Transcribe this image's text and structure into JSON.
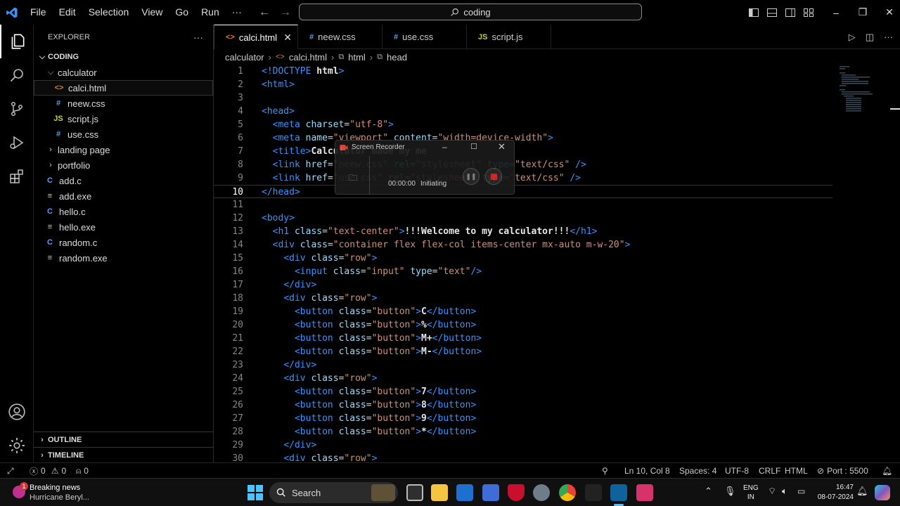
{
  "menu": [
    "File",
    "Edit",
    "Selection",
    "View",
    "Go",
    "Run",
    "···"
  ],
  "command_center": "coding",
  "sidebar": {
    "title": "EXPLORER",
    "more": "···",
    "root": "CODING",
    "tree": [
      {
        "label": "calculator",
        "type": "folder-open",
        "indent": 1
      },
      {
        "label": "calci.html",
        "type": "html",
        "indent": 2,
        "selected": true
      },
      {
        "label": "neew.css",
        "type": "css",
        "indent": 2
      },
      {
        "label": "script.js",
        "type": "js",
        "indent": 2
      },
      {
        "label": "use.css",
        "type": "css",
        "indent": 2
      },
      {
        "label": "landing page",
        "type": "folder",
        "indent": 1
      },
      {
        "label": "portfolio",
        "type": "folder",
        "indent": 1
      },
      {
        "label": "add.c",
        "type": "c",
        "indent": 1
      },
      {
        "label": "add.exe",
        "type": "exe",
        "indent": 1
      },
      {
        "label": "hello.c",
        "type": "c",
        "indent": 1
      },
      {
        "label": "hello.exe",
        "type": "exe",
        "indent": 1
      },
      {
        "label": "random.c",
        "type": "c",
        "indent": 1
      },
      {
        "label": "random.exe",
        "type": "exe",
        "indent": 1
      }
    ],
    "outline": "OUTLINE",
    "timeline": "TIMELINE"
  },
  "tabs": [
    {
      "label": "calci.html",
      "icon": "html",
      "active": true
    },
    {
      "label": "neew.css",
      "icon": "css"
    },
    {
      "label": "use.css",
      "icon": "css"
    },
    {
      "label": "script.js",
      "icon": "js"
    }
  ],
  "breadcrumb": [
    "calculator",
    "calci.html",
    "html",
    "head"
  ],
  "editor": {
    "current_line": 10,
    "lines": [
      [
        [
          "t",
          "<!DOCTYPE "
        ],
        [
          "tx",
          "html"
        ],
        [
          "t",
          ">"
        ]
      ],
      [
        [
          "t",
          "<html>"
        ]
      ],
      [],
      [
        [
          "t",
          "<head>"
        ]
      ],
      [
        [
          "n",
          "  "
        ],
        [
          "t",
          "<meta "
        ],
        [
          "at",
          "charset"
        ],
        [
          "tn",
          "="
        ],
        [
          "st",
          "\"utf-8\""
        ],
        [
          "t",
          ">"
        ]
      ],
      [
        [
          "n",
          "  "
        ],
        [
          "t",
          "<meta "
        ],
        [
          "at",
          "name"
        ],
        [
          "tn",
          "="
        ],
        [
          "st",
          "\"viewport\" "
        ],
        [
          "at",
          "content"
        ],
        [
          "tn",
          "="
        ],
        [
          "st",
          "\"width=device-width\""
        ],
        [
          "t",
          ">"
        ]
      ],
      [
        [
          "n",
          "  "
        ],
        [
          "t",
          "<title>"
        ],
        [
          "tx",
          "Calculator made my me"
        ]
      ],
      [
        [
          "n",
          "  "
        ],
        [
          "t",
          "<link "
        ],
        [
          "at",
          "href"
        ],
        [
          "tn",
          "="
        ],
        [
          "st",
          "\"neew.css\" "
        ],
        [
          "at",
          "rel"
        ],
        [
          "tn",
          "="
        ],
        [
          "st",
          "\"stylesheet\" "
        ],
        [
          "at",
          "type"
        ],
        [
          "tn",
          "="
        ],
        [
          "st",
          "\"text/css\""
        ],
        [
          "t",
          " />"
        ]
      ],
      [
        [
          "n",
          "  "
        ],
        [
          "t",
          "<link "
        ],
        [
          "at",
          "href"
        ],
        [
          "tn",
          "="
        ],
        [
          "st",
          "\"use.css\" "
        ],
        [
          "at",
          "rel"
        ],
        [
          "tn",
          "="
        ],
        [
          "st",
          "\"stylesheet\" "
        ],
        [
          "at",
          "type"
        ],
        [
          "tn",
          "="
        ],
        [
          "st",
          "\"text/css\""
        ],
        [
          "t",
          " />"
        ]
      ],
      [
        [
          "t",
          "</head>"
        ]
      ],
      [],
      [
        [
          "t",
          "<body>"
        ]
      ],
      [
        [
          "n",
          "  "
        ],
        [
          "t",
          "<h1 "
        ],
        [
          "at",
          "class"
        ],
        [
          "tn",
          "="
        ],
        [
          "st",
          "\"text-center\""
        ],
        [
          "t",
          ">"
        ],
        [
          "tx",
          "!!!Welcome to my calculator!!!"
        ],
        [
          "t",
          "</h1>"
        ]
      ],
      [
        [
          "n",
          "  "
        ],
        [
          "t",
          "<div "
        ],
        [
          "at",
          "class"
        ],
        [
          "tn",
          "="
        ],
        [
          "st",
          "\"container flex flex-col items-center mx-auto m-w-20\""
        ],
        [
          "t",
          ">"
        ]
      ],
      [
        [
          "n",
          "    "
        ],
        [
          "t",
          "<div "
        ],
        [
          "at",
          "class"
        ],
        [
          "tn",
          "="
        ],
        [
          "st",
          "\"row\""
        ],
        [
          "t",
          ">"
        ]
      ],
      [
        [
          "n",
          "      "
        ],
        [
          "t",
          "<input "
        ],
        [
          "at",
          "class"
        ],
        [
          "tn",
          "="
        ],
        [
          "st",
          "\"input\" "
        ],
        [
          "at",
          "type"
        ],
        [
          "tn",
          "="
        ],
        [
          "st",
          "\"text\""
        ],
        [
          "t",
          "/>"
        ]
      ],
      [
        [
          "n",
          "    "
        ],
        [
          "t",
          "</div>"
        ]
      ],
      [
        [
          "n",
          "    "
        ],
        [
          "t",
          "<div "
        ],
        [
          "at",
          "class"
        ],
        [
          "tn",
          "="
        ],
        [
          "st",
          "\"row\""
        ],
        [
          "t",
          ">"
        ]
      ],
      [
        [
          "n",
          "      "
        ],
        [
          "t",
          "<button "
        ],
        [
          "at",
          "class"
        ],
        [
          "tn",
          "="
        ],
        [
          "st",
          "\"button\""
        ],
        [
          "t",
          ">"
        ],
        [
          "tx",
          "C"
        ],
        [
          "t",
          "</button>"
        ]
      ],
      [
        [
          "n",
          "      "
        ],
        [
          "t",
          "<button "
        ],
        [
          "at",
          "class"
        ],
        [
          "tn",
          "="
        ],
        [
          "st",
          "\"button\""
        ],
        [
          "t",
          ">"
        ],
        [
          "tx",
          "%"
        ],
        [
          "t",
          "</button>"
        ]
      ],
      [
        [
          "n",
          "      "
        ],
        [
          "t",
          "<button "
        ],
        [
          "at",
          "class"
        ],
        [
          "tn",
          "="
        ],
        [
          "st",
          "\"button\""
        ],
        [
          "t",
          ">"
        ],
        [
          "tx",
          "M+"
        ],
        [
          "t",
          "</button>"
        ]
      ],
      [
        [
          "n",
          "      "
        ],
        [
          "t",
          "<button "
        ],
        [
          "at",
          "class"
        ],
        [
          "tn",
          "="
        ],
        [
          "st",
          "\"button\""
        ],
        [
          "t",
          ">"
        ],
        [
          "tx",
          "M-"
        ],
        [
          "t",
          "</button>"
        ]
      ],
      [
        [
          "n",
          "    "
        ],
        [
          "t",
          "</div>"
        ]
      ],
      [
        [
          "n",
          "    "
        ],
        [
          "t",
          "<div "
        ],
        [
          "at",
          "class"
        ],
        [
          "tn",
          "="
        ],
        [
          "st",
          "\"row\""
        ],
        [
          "t",
          ">"
        ]
      ],
      [
        [
          "n",
          "      "
        ],
        [
          "t",
          "<button "
        ],
        [
          "at",
          "class"
        ],
        [
          "tn",
          "="
        ],
        [
          "st",
          "\"button\""
        ],
        [
          "t",
          ">"
        ],
        [
          "tx",
          "7"
        ],
        [
          "t",
          "</button>"
        ]
      ],
      [
        [
          "n",
          "      "
        ],
        [
          "t",
          "<button "
        ],
        [
          "at",
          "class"
        ],
        [
          "tn",
          "="
        ],
        [
          "st",
          "\"button\""
        ],
        [
          "t",
          ">"
        ],
        [
          "tx",
          "8"
        ],
        [
          "t",
          "</button>"
        ]
      ],
      [
        [
          "n",
          "      "
        ],
        [
          "t",
          "<button "
        ],
        [
          "at",
          "class"
        ],
        [
          "tn",
          "="
        ],
        [
          "st",
          "\"button\""
        ],
        [
          "t",
          ">"
        ],
        [
          "tx",
          "9"
        ],
        [
          "t",
          "</button>"
        ]
      ],
      [
        [
          "n",
          "      "
        ],
        [
          "t",
          "<button "
        ],
        [
          "at",
          "class"
        ],
        [
          "tn",
          "="
        ],
        [
          "st",
          "\"button\""
        ],
        [
          "t",
          ">"
        ],
        [
          "tx",
          "*"
        ],
        [
          "t",
          "</button>"
        ]
      ],
      [
        [
          "n",
          "    "
        ],
        [
          "t",
          "</div>"
        ]
      ],
      [
        [
          "n",
          "    "
        ],
        [
          "t",
          "<div "
        ],
        [
          "at",
          "class"
        ],
        [
          "tn",
          "="
        ],
        [
          "st",
          "\"row\""
        ],
        [
          "t",
          ">"
        ]
      ]
    ]
  },
  "recorder": {
    "title": "Screen Recorder",
    "time": "00:00:00",
    "status": "Initiating"
  },
  "status": {
    "problems_errors": "0",
    "problems_warnings": "0",
    "ports": "0",
    "position": "Ln 10, Col 8",
    "spaces": "Spaces: 4",
    "encoding": "UTF-8",
    "eol": "CRLF",
    "language": "HTML",
    "port": "Port : 5500"
  },
  "taskbar": {
    "news_title": "Breaking news",
    "news_sub": "Hurricane Beryl...",
    "news_badge": "1",
    "search": "Search",
    "lang1": "ENG",
    "lang2": "IN",
    "time": "16:47",
    "date": "08-07-2024"
  },
  "colors": {
    "accent": "#3794ff",
    "string": "#ce9178",
    "attr": "#9cdcfe",
    "html_icon": "#e37933",
    "css_icon": "#42a5f5",
    "js_icon": "#cbcb41",
    "c_icon": "#599eff"
  }
}
